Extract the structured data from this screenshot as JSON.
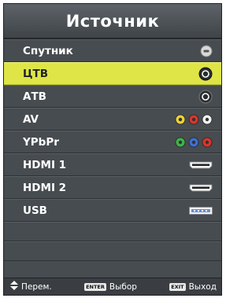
{
  "title": "Источник",
  "sources": [
    {
      "label": "Спутник",
      "icon": "satellite-connector-icon"
    },
    {
      "label": "ЦТВ",
      "icon": "coax-connector-icon",
      "selected": true
    },
    {
      "label": "АТВ",
      "icon": "coax-connector-icon"
    },
    {
      "label": "AV",
      "icon": "rca-composite-connector-icon",
      "colors": [
        "#e8d23a",
        "#d8362d",
        "#f2f2f2"
      ]
    },
    {
      "label": "YPbPr",
      "icon": "component-connector-icon",
      "colors": [
        "#3fb34a",
        "#3f6fd0",
        "#d8362d"
      ]
    },
    {
      "label": "HDMI 1",
      "icon": "hdmi-connector-icon"
    },
    {
      "label": "HDMI 2",
      "icon": "hdmi-connector-icon"
    },
    {
      "label": "USB",
      "icon": "usb-connector-icon"
    }
  ],
  "footer": {
    "move_label": "Перем.",
    "enter_key": "ENTER",
    "select_label": "Выбор",
    "exit_key": "EXIT",
    "exit_label": "Выход"
  },
  "colors": {
    "selected_row": "#dfe546",
    "panel": "#474c50"
  }
}
